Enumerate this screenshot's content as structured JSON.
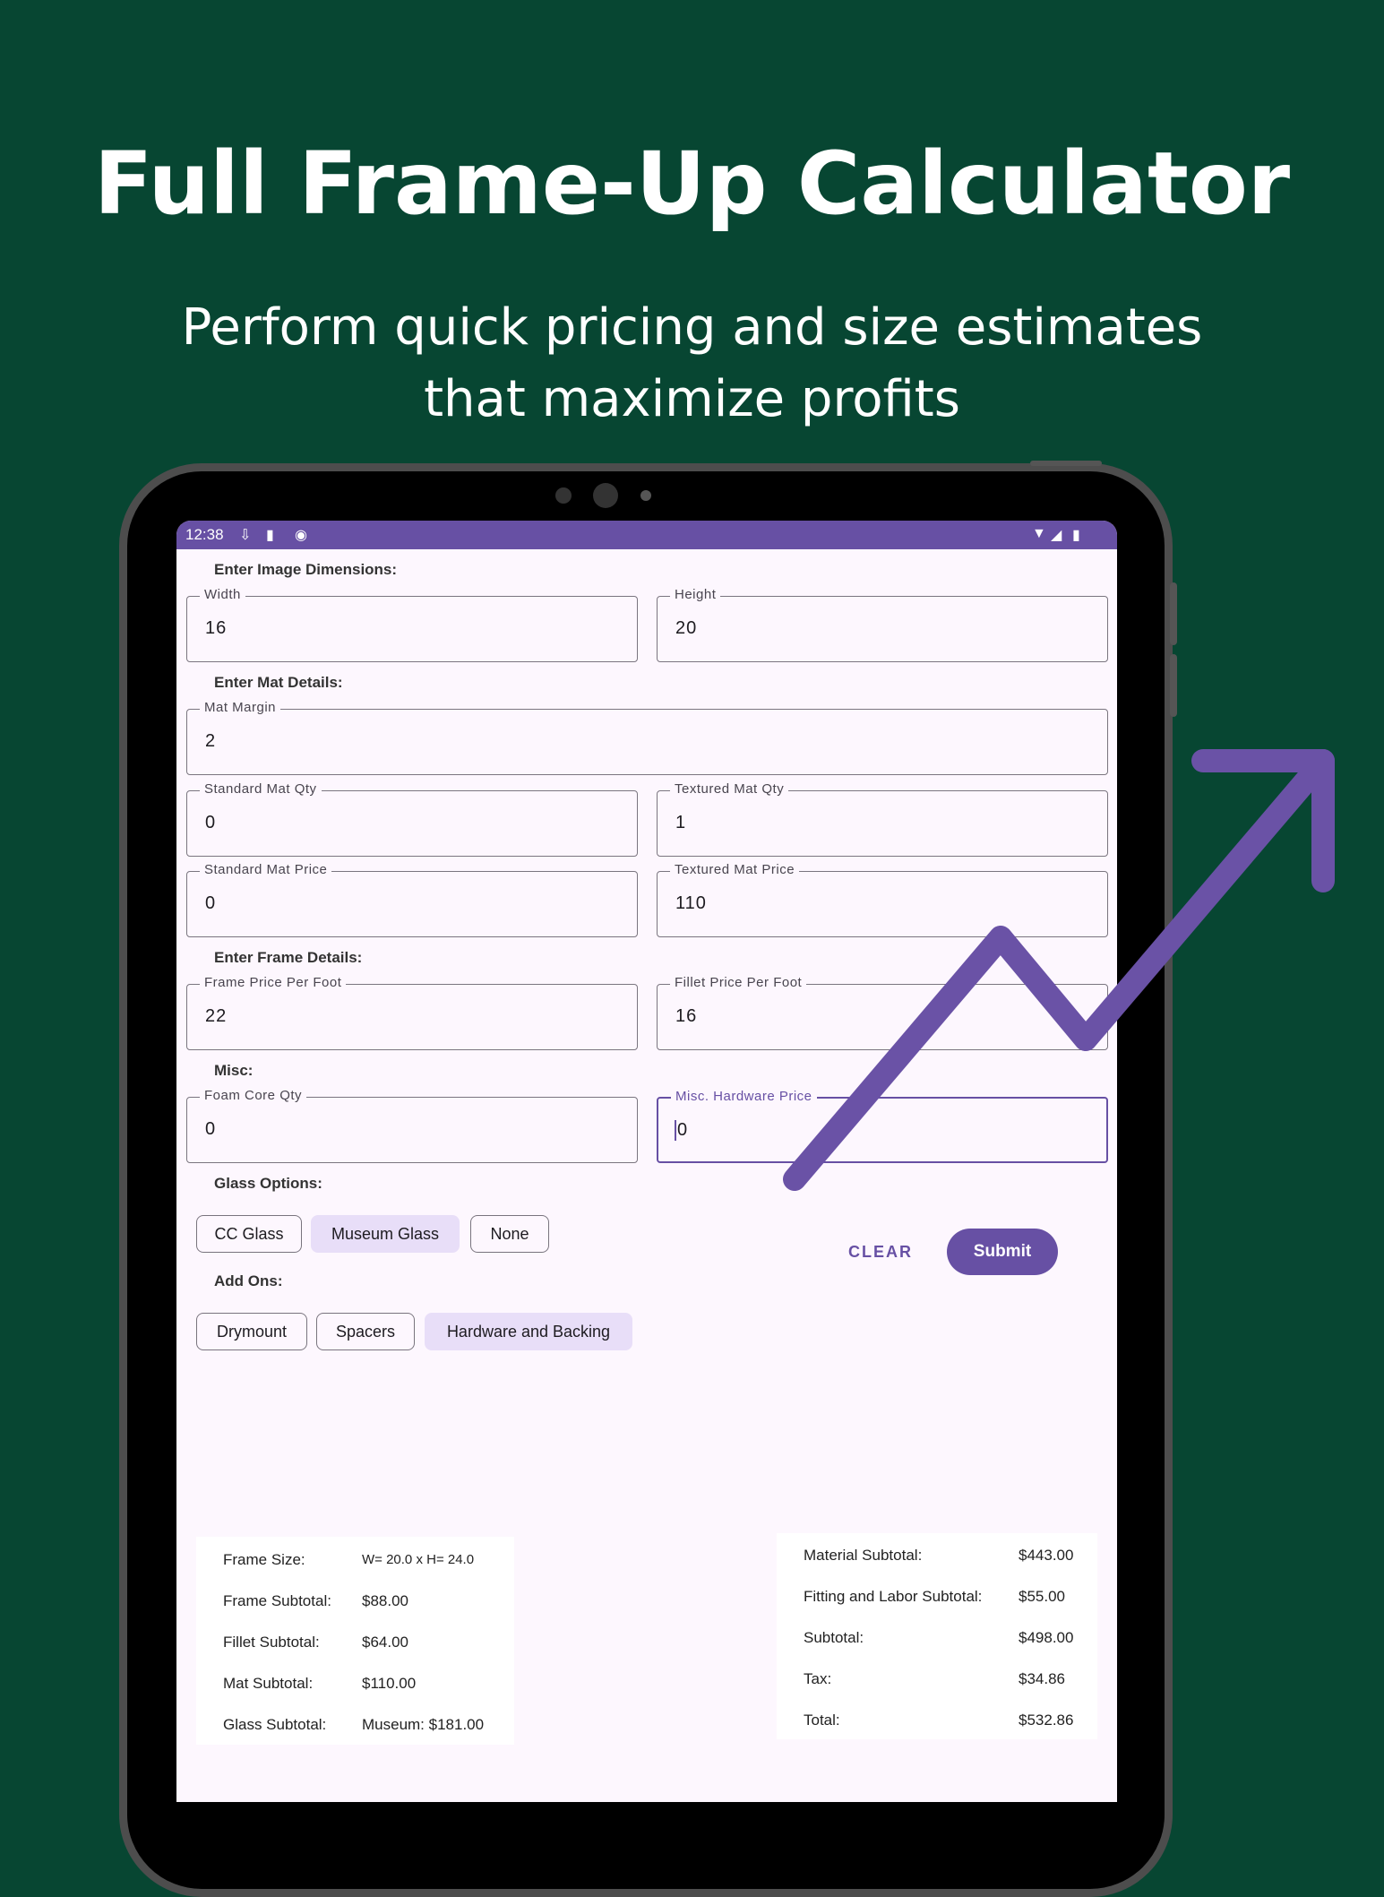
{
  "hero": {
    "title": "Full Frame-Up Calculator",
    "subtitle": "Perform quick pricing and size estimates that maximize profits"
  },
  "status_bar": {
    "time": "12:38"
  },
  "sections": {
    "image": "Enter Image Dimensions:",
    "mat": "Enter Mat Details:",
    "frame": "Enter Frame Details:",
    "misc": "Misc:",
    "glass": "Glass Options:",
    "addons": "Add Ons:"
  },
  "fields": {
    "width": {
      "label": "Width",
      "value": "16"
    },
    "height": {
      "label": "Height",
      "value": "20"
    },
    "mat_margin": {
      "label": "Mat Margin",
      "value": "2"
    },
    "standard_mat_qty": {
      "label": "Standard Mat Qty",
      "value": "0"
    },
    "textured_mat_qty": {
      "label": "Textured Mat Qty",
      "value": "1"
    },
    "standard_mat_price": {
      "label": "Standard Mat Price",
      "value": "0"
    },
    "textured_mat_price": {
      "label": "Textured Mat Price",
      "value": "110"
    },
    "frame_price": {
      "label": "Frame Price Per Foot",
      "value": "22"
    },
    "fillet_price": {
      "label": "Fillet Price Per Foot",
      "value": "16"
    },
    "foam_core_qty": {
      "label": "Foam Core Qty",
      "value": "0"
    },
    "misc_hardware_price": {
      "label": "Misc. Hardware Price",
      "value": "0"
    }
  },
  "glass_chips": [
    {
      "label": "CC Glass",
      "selected": false
    },
    {
      "label": "Museum Glass",
      "selected": true
    },
    {
      "label": "None",
      "selected": false
    }
  ],
  "addon_chips": [
    {
      "label": "Drymount",
      "selected": false
    },
    {
      "label": "Spacers",
      "selected": false
    },
    {
      "label": "Hardware and Backing",
      "selected": true
    }
  ],
  "buttons": {
    "clear": "CLEAR",
    "submit": "Submit"
  },
  "summary_left": [
    {
      "label": "Frame Size:",
      "value": "W= 20.0 x H= 24.0"
    },
    {
      "label": "Frame Subtotal:",
      "value": "$88.00"
    },
    {
      "label": "Fillet Subtotal:",
      "value": "$64.00"
    },
    {
      "label": "Mat Subtotal:",
      "value": "$110.00"
    },
    {
      "label": "Glass Subtotal:",
      "value": "Museum: $181.00"
    }
  ],
  "summary_right": [
    {
      "label": "Material Subtotal:",
      "value": "$443.00"
    },
    {
      "label": "Fitting and Labor Subtotal:",
      "value": "$55.00"
    },
    {
      "label": "Subtotal:",
      "value": "$498.00"
    },
    {
      "label": "Tax:",
      "value": "$34.86"
    },
    {
      "label": "Total:",
      "value": "$532.86"
    }
  ],
  "colors": {
    "background": "#074632",
    "accent": "#6750a4",
    "chip_selected": "#e8def8",
    "screen": "#fdf7fe"
  },
  "icons": [
    "download-icon",
    "sd-card-icon",
    "sync-icon",
    "wifi-icon",
    "signal-icon",
    "battery-icon",
    "trend-arrow-icon"
  ]
}
